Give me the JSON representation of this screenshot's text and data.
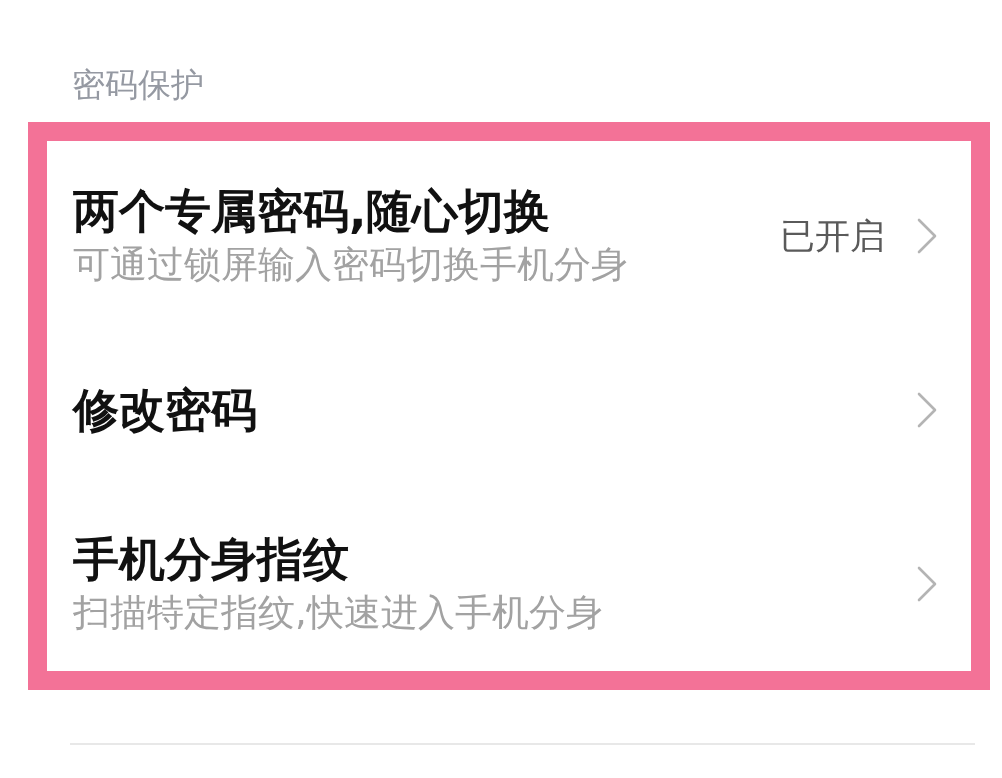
{
  "section_title": "密码保护",
  "items": [
    {
      "title": "两个专属密码,随心切换",
      "subtitle": "可通过锁屏输入密码切换手机分身",
      "status": "已开启"
    },
    {
      "title": "修改密码"
    },
    {
      "title": "手机分身指纹",
      "subtitle": "扫描特定指纹,快速进入手机分身"
    }
  ]
}
